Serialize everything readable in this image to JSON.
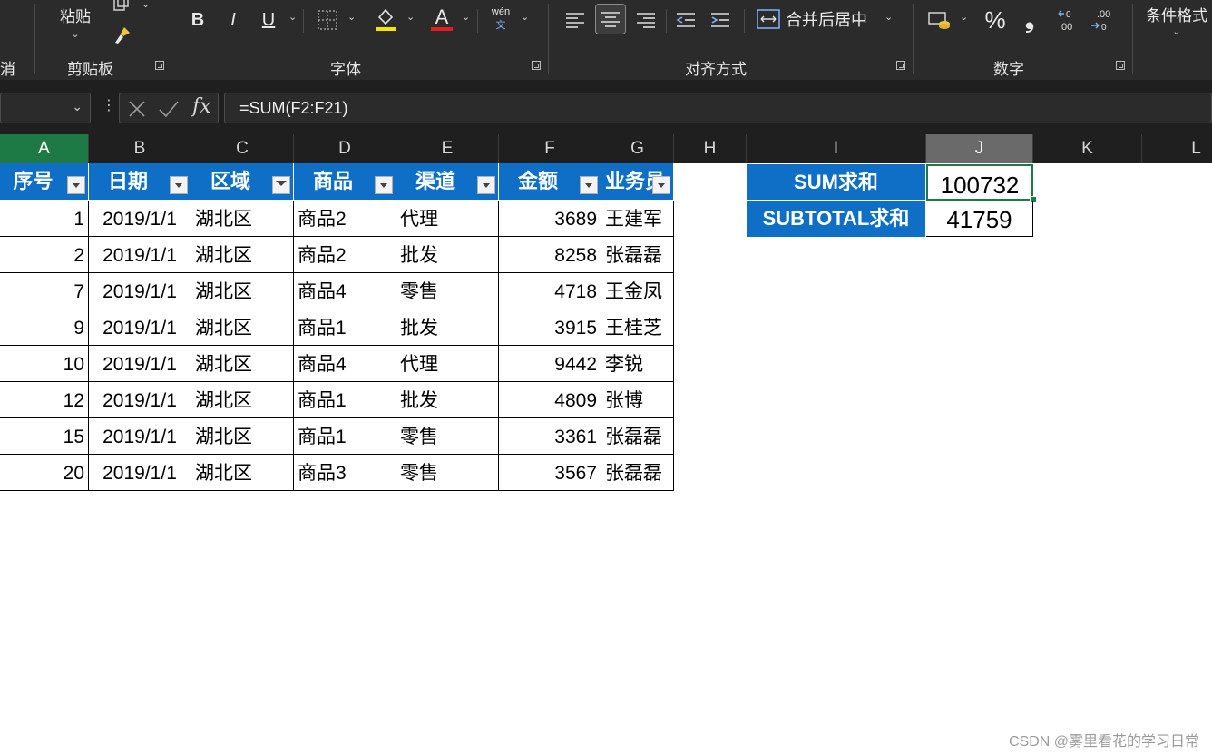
{
  "ribbon": {
    "cancel_partial": "消",
    "paste_label": "粘贴",
    "groups": {
      "clipboard": "剪贴板",
      "font": "字体",
      "alignment": "对齐方式",
      "number": "数字",
      "conditional_format": "条件格式"
    },
    "bold": "B",
    "italic": "I",
    "underline": "U",
    "font_color_letter": "A",
    "phonetic_top": "wén",
    "phonetic_bottom": "文",
    "merge_center": "合并后居中",
    "percent": "%",
    "comma": "❟",
    "inc_decimal": ".00",
    "dec_decimal": ".00",
    "accent_yellow": "#f5e300",
    "accent_red": "#e02020"
  },
  "formula_bar": {
    "formula": "=SUM(F2:F21)",
    "fx": "fx"
  },
  "columns": [
    "A",
    "B",
    "C",
    "D",
    "E",
    "F",
    "G",
    "H",
    "I",
    "J",
    "K",
    "L"
  ],
  "table": {
    "headers": [
      "序号",
      "日期",
      "区域",
      "商品",
      "渠道",
      "金额",
      "业务员"
    ],
    "rows": [
      [
        "1",
        "2019/1/1",
        "湖北区",
        "商品2",
        "代理",
        "3689",
        "王建军"
      ],
      [
        "2",
        "2019/1/1",
        "湖北区",
        "商品2",
        "批发",
        "8258",
        "张磊磊"
      ],
      [
        "7",
        "2019/1/1",
        "湖北区",
        "商品4",
        "零售",
        "4718",
        "王金凤"
      ],
      [
        "9",
        "2019/1/1",
        "湖北区",
        "商品1",
        "批发",
        "3915",
        "王桂芝"
      ],
      [
        "10",
        "2019/1/1",
        "湖北区",
        "商品4",
        "代理",
        "9442",
        "李锐"
      ],
      [
        "12",
        "2019/1/1",
        "湖北区",
        "商品1",
        "批发",
        "4809",
        "张博"
      ],
      [
        "15",
        "2019/1/1",
        "湖北区",
        "商品1",
        "零售",
        "3361",
        "张磊磊"
      ],
      [
        "20",
        "2019/1/1",
        "湖北区",
        "商品3",
        "零售",
        "3567",
        "张磊磊"
      ]
    ]
  },
  "summary": {
    "sum_label": "SUM求和",
    "sum_value": "100732",
    "subtotal_label": "SUBTOTAL求和",
    "subtotal_value": "41759"
  },
  "watermark": "CSDN @雾里看花的学习日常",
  "colors": {
    "header_blue": "#0f6fc6",
    "ribbon_bg": "#2b2b2b",
    "selection_green": "#1e7a45"
  }
}
